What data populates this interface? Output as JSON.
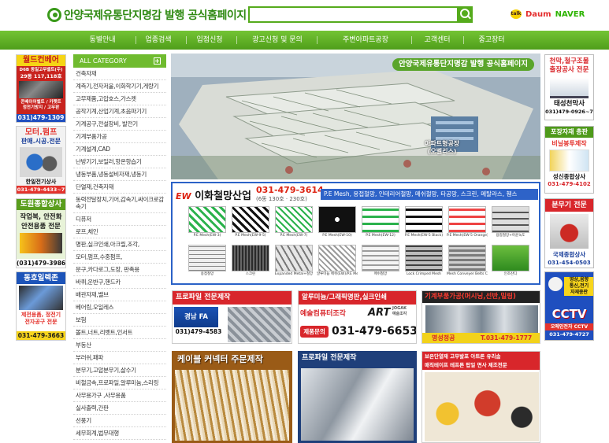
{
  "header": {
    "site_title": "안양국제유통단지명감 발행 공식홈페이지",
    "search_placeholder": "",
    "portals": {
      "kakao": "talk",
      "daum": "Daum",
      "naver": "NAVER"
    }
  },
  "nav": {
    "items": [
      "동별안내",
      "업종검색",
      "입점신청",
      "광고신청 및 문의",
      "주변아파트공장",
      "고객센터",
      "중고장터"
    ]
  },
  "left_ads": [
    {
      "title": "월드컨베어",
      "line2": "D6B 동일고무벨트(주)",
      "line3": "29동 117,118호",
      "line4": "콘베이어벨트 / 카펫트",
      "line5": "정전기방지 / 고무판",
      "phone": "031)479-1309"
    },
    {
      "title": "모터.펌프",
      "line2": "판매.시공.전문",
      "name": "한일전기상사",
      "phone": "031-479-4433~7"
    },
    {
      "title": "도원종합상사",
      "line2": "작업복, 안전화",
      "line3": "안전용품 전문",
      "phone": "(031)479-3986"
    },
    {
      "title": "동호일렉존",
      "line2": "제전용품, 정전기",
      "line3": "전자공구 전문",
      "phone": "031-479-3663"
    }
  ],
  "categories": {
    "title": "ALL CATEGORY",
    "items": [
      "건축자재",
      "계측기,전자저울,이화학기기,게량기",
      "고무제품,고압호스,가스켓",
      "공작기계,산업기계,초음파기기",
      "기계공구,전설장비, 발전기",
      "기계부품가공",
      "기계설계,CAD",
      "난방기기,보일러,항온항습기",
      "냉동부품,냉동설비자재,냉동기",
      "단열재,건축자재",
      "동력전달장치,기어,감속기,싸이크로감속기",
      "디퓨저",
      "로프,체인",
      "명판,실크인쇄,아크릴,조각,",
      "모터,펌프,수중펌프,",
      "문구,카다로그,도장, 판촉용",
      "바퀴,운반구,핸드카",
      "배관자재,밸브",
      "베어링,오일레스",
      "보험",
      "볼트,너트,리벳트,인서트",
      "부동산",
      "부러쉬,패파",
      "분무기,고압분무기,살수기",
      "비철금속,프로파일,알루미늄,스리링",
      "사무용가구 ,사무용품",
      "실사출력,간판",
      "선풍기",
      "세무회계,법무대행"
    ]
  },
  "hero": {
    "title": "안양국제유통단지명감 발행 공식홈페이지",
    "label1": "아파트형공장",
    "label2": "(오벨리스)"
  },
  "mesh_banner": {
    "brand": "이화철망산업",
    "brand_mark": "EW",
    "phone": "031-479-3614",
    "sub": "(6동 130호 · 230호)",
    "products": "P.E Mesh, 용접철망, 인테리어철망, 메쉬철망, 타공망, 스크린, 메탈라스, 휀스",
    "cells": [
      "P.E Mesh(EW-3)",
      "P.E Mesh(EW-9-5)",
      "P.E Mesh(EW-7)",
      "P.E Mesh(EW-10)",
      "P.E Mesh(EW-12)",
      "P.E Mesh(EW-5 Black)",
      "P.E Mesh(EW-5 Orange)",
      "용접철망+아윤녹도",
      "용접철망",
      "스크린",
      "Expanded Metal+철망",
      "알루미늄 메쉬(EW)/P.E Mesh",
      "메쉬철망",
      "Lock Crimped Mesh",
      "Mesh Conveyer Belts Chain Nets",
      "인조잔디"
    ]
  },
  "right_ads": [
    {
      "line1": "천막,철구조물",
      "line2": "출장공사 전문",
      "name": "태성천막사",
      "phone": "031)479-0926~7"
    },
    {
      "title": "포장자재 총판",
      "line2": "비닐봉투제작",
      "name": "성신종합상사",
      "phone": "031-479-4102"
    },
    {
      "title": "분무기 전문",
      "name": "국제종합상사",
      "phone": "031-454-0503"
    },
    {
      "line1": "영상,음향",
      "line2": "통신,전기",
      "line3": "자재종판",
      "logo": "CCTV",
      "name": "오메인전자 CCTV",
      "phone": "031-479-4727"
    }
  ],
  "row3": [
    {
      "title": "프로파일 전문제작",
      "name": "경남 FA",
      "phone": "031)479-4583"
    },
    {
      "title": "알루미늄/그래픽명판,실크인쇄",
      "name": "예술컴퓨터조각",
      "logo": "ART",
      "logo2": "JOGAK",
      "logo3": "예술조각",
      "btn": "제품문의",
      "phone": "031-479-6653"
    },
    {
      "title": "기계부품가공(머시닝,선반,밀링)",
      "name": "명성정공",
      "phone": "T.031-479-1777"
    }
  ],
  "row4": [
    {
      "title": "케이블 커넥터 주문제작"
    },
    {
      "title": "프로파일 전문제작"
    },
    {
      "title": "보온단열재 고무발포 아트론 유리솜",
      "line2": "매직테이프 테프론 탑일 면사 제조전문"
    }
  ]
}
